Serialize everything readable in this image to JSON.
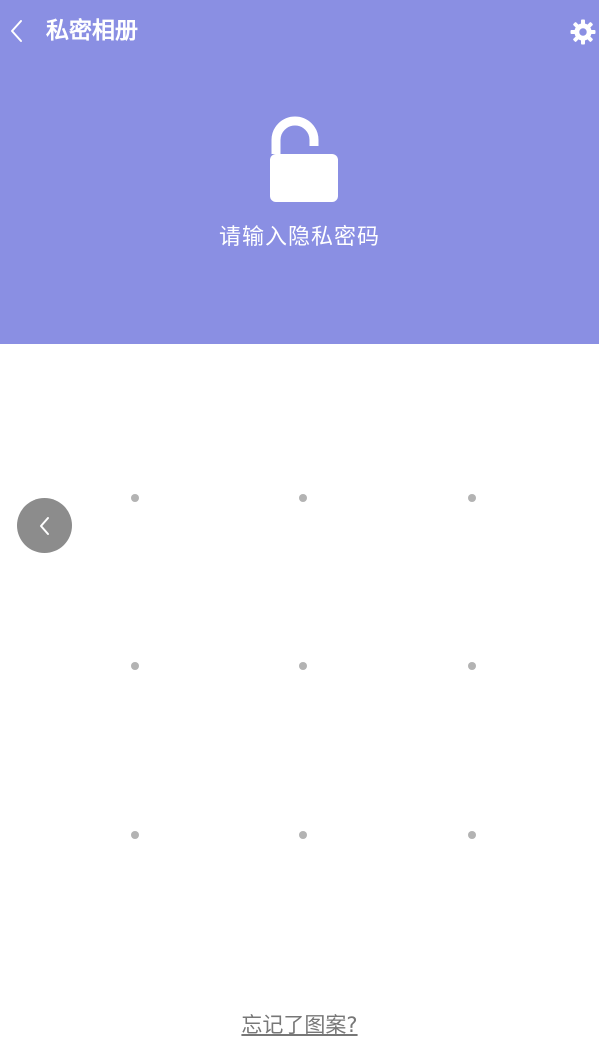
{
  "header": {
    "title": "私密相册",
    "prompt": "请输入隐私密码",
    "icons": {
      "back": "chevron-left-icon",
      "settings": "gear-icon",
      "lock": "unlocked-padlock-icon"
    },
    "background_color": "#8a8fe3"
  },
  "pattern_lock": {
    "rows": 3,
    "cols": 3,
    "dot_color": "#b3b3b3"
  },
  "side_back": {
    "icon": "chevron-left-icon",
    "color": "#8c8c8c"
  },
  "footer": {
    "forgot_label": "忘记了图案?"
  }
}
